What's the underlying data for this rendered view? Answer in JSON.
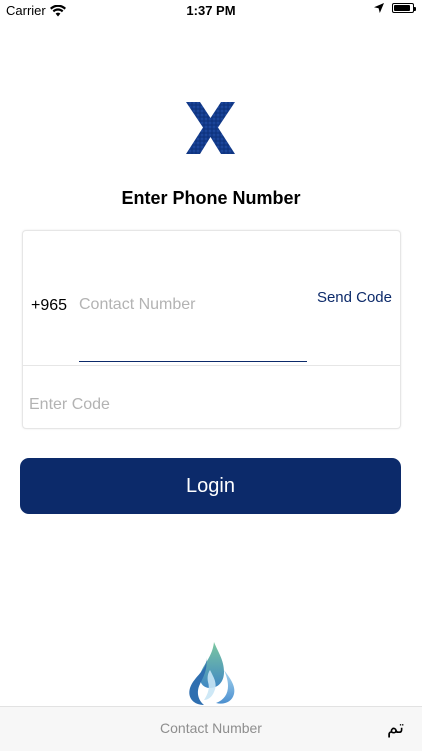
{
  "status_bar": {
    "carrier": "Carrier",
    "time": "1:37 PM",
    "icons": [
      "wifi-icon",
      "location-arrow-icon",
      "battery-icon"
    ],
    "battery_level": 0.9
  },
  "header": {
    "logo_icon": "x-logo-icon",
    "title": "Enter Phone Number"
  },
  "form": {
    "country_code": "+965",
    "contact_placeholder": "Contact Number",
    "contact_value": "",
    "send_code_label": "Send Code",
    "code_placeholder": "Enter Code",
    "code_value": ""
  },
  "login_button": {
    "label": "Login"
  },
  "footer": {
    "brand_icon": "water-drop-logo-icon"
  },
  "keyboard_accessory": {
    "field_label": "Contact Number",
    "done_label": "تم"
  },
  "colors": {
    "primary": "#0c2a6a",
    "placeholder": "#b3b3b3",
    "accessory_bg": "#f7f7f7"
  }
}
